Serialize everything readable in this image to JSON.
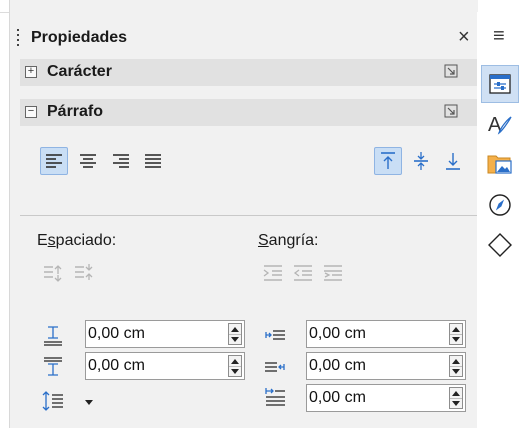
{
  "panel": {
    "title": "Propiedades",
    "close_glyph": "×"
  },
  "sections": {
    "character": {
      "label": "Carácter",
      "expander": "+"
    },
    "paragraph": {
      "label": "Párrafo",
      "expander": "−"
    }
  },
  "alignment": {
    "horizontal": [
      "align-left-icon",
      "align-center-icon",
      "align-right-icon",
      "align-justify-icon"
    ],
    "horizontal_active": "align-left-icon",
    "vertical": [
      "align-top-icon",
      "align-middle-icon",
      "align-bottom-icon"
    ],
    "vertical_active": "align-top-icon"
  },
  "spacing": {
    "label_prefix": "E",
    "label_underlined": "s",
    "label_suffix": "paciado:",
    "above_value": "0,00 cm",
    "below_value": "0,00 cm"
  },
  "indent": {
    "label_underlined": "S",
    "label_suffix": "angría:",
    "before_value": "0,00 cm",
    "after_value": "0,00 cm",
    "first_line_value": "0,00 cm"
  },
  "sidebar_rail": {
    "menu_glyph": "≡",
    "tabs": [
      "properties-icon",
      "styles-icon",
      "gallery-icon",
      "navigator-icon",
      "shapes-icon"
    ],
    "active": "properties-icon"
  },
  "colors": {
    "accent": "#2a6fc9",
    "active_bg": "#c9def5",
    "section_bg": "#e1e1e1"
  }
}
